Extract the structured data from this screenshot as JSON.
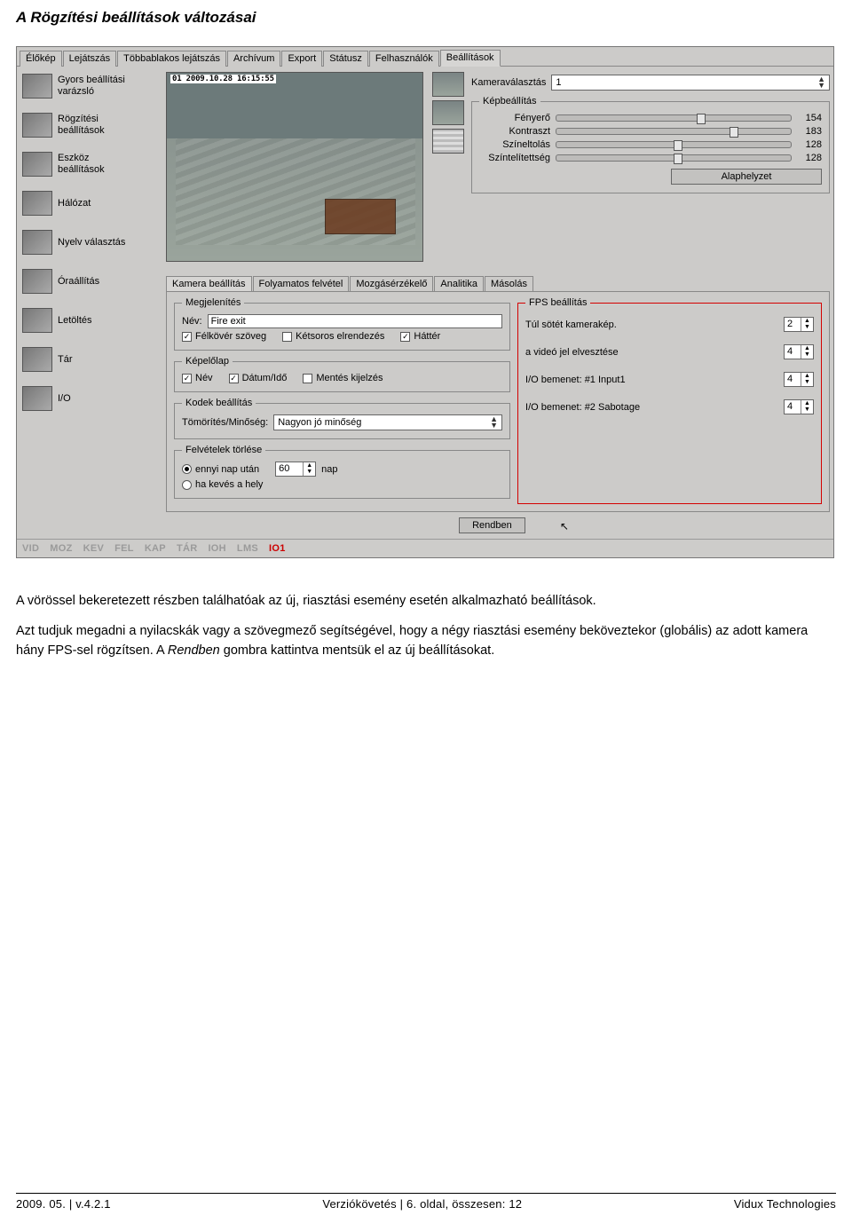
{
  "page_title": "A Rögzítési beállítások változásai",
  "top_tabs": [
    "Élőkép",
    "Lejátszás",
    "Többablakos lejátszás",
    "Archívum",
    "Export",
    "Státusz",
    "Felhasználók",
    "Beállítások"
  ],
  "top_tab_active": "Beállítások",
  "sidebar": [
    "Gyors beállítási\nvarázsló",
    "Rögzítési\nbeállítások",
    "Eszköz\nbeállítások",
    "Hálózat",
    "Nyelv választás",
    "Óraállítás",
    "Letöltés",
    "Tár",
    "I/O"
  ],
  "preview_timestamp": "01 2009.10.28 16:15:55",
  "cam_select_label": "Kameraválasztás",
  "cam_select_value": "1",
  "image_settings_legend": "Képbeállítás",
  "sliders": [
    {
      "label": "Fényerő",
      "value": "154",
      "pos": 60
    },
    {
      "label": "Kontraszt",
      "value": "183",
      "pos": 74
    },
    {
      "label": "Színeltolás",
      "value": "128",
      "pos": 50
    },
    {
      "label": "Színtelítettség",
      "value": "128",
      "pos": 50
    }
  ],
  "reset_button": "Alaphelyzet",
  "sub_tabs": [
    "Kamera beállítás",
    "Folyamatos felvétel",
    "Mozgásérzékelő",
    "Analitika",
    "Másolás"
  ],
  "sub_tab_active": "Kamera beállítás",
  "display_legend": "Megjelenítés",
  "name_label": "Név:",
  "name_value": "Fire exit",
  "checkboxes_display": [
    {
      "label": "Félkövér szöveg",
      "checked": true
    },
    {
      "label": "Kétsoros elrendezés",
      "checked": false
    },
    {
      "label": "Háttér",
      "checked": true
    }
  ],
  "overlay_legend": "Képelőlap",
  "checkboxes_overlay": [
    {
      "label": "Név",
      "checked": true
    },
    {
      "label": "Dátum/Idő",
      "checked": true
    },
    {
      "label": "Mentés kijelzés",
      "checked": false
    }
  ],
  "codec_legend": "Kodek beállítás",
  "codec_label": "Tömörítés/Minőség:",
  "codec_value": "Nagyon jó minőség",
  "delete_legend": "Felvételek törlése",
  "delete_radio1_label": "ennyi nap után",
  "delete_days": "60",
  "delete_days_unit": "nap",
  "delete_radio2_label": "ha kevés a hely",
  "delete_selected": 0,
  "fps_legend": "FPS beállítás",
  "fps_rows": [
    {
      "label": "Túl sötét kamerakép.",
      "value": "2"
    },
    {
      "label": "a videó jel elvesztése",
      "value": "4"
    },
    {
      "label": "I/O bemenet: #1 Input1",
      "value": "4"
    },
    {
      "label": "I/O bemenet: #2 Sabotage",
      "value": "4"
    }
  ],
  "submit_label": "Rendben",
  "badges": [
    "VID",
    "MOZ",
    "KEV",
    "FEL",
    "KAP",
    "TÁR",
    "IOH",
    "LMS",
    "IO1"
  ],
  "badge_active": "IO1",
  "para1": "A vörössel bekeretezett részben találhatóak az új, riasztási esemény esetén alkalmazható beállítások.",
  "para2_a": "Azt tudjuk megadni a nyilacskák vagy a szövegmező segítségével, hogy a négy riasztási esemény beköveztekor (globális) az adott kamera hány FPS-sel rögzítsen. A ",
  "para2_em": "Rendben",
  "para2_b": " gombra kattintva mentsük el az új beállításokat.",
  "footer_left": "2009. 05. | v.4.2.1",
  "footer_center": "Verziókövetés | 6. oldal, összesen: 12",
  "footer_right": "Vidux Technologies"
}
